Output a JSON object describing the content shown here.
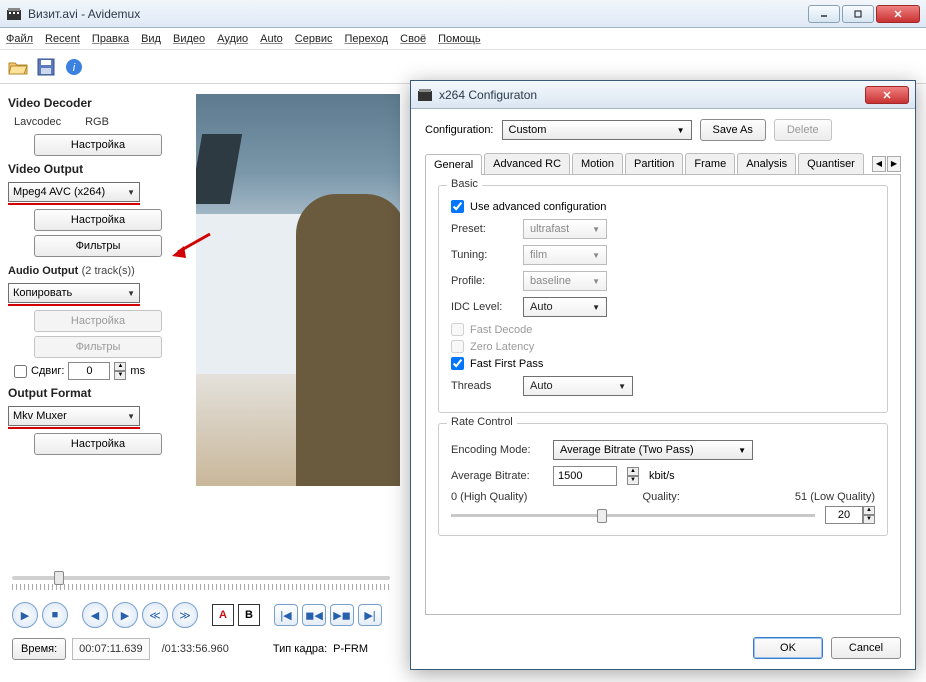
{
  "window": {
    "title": "Визит.avi - Avidemux"
  },
  "menu": [
    "Файл",
    "Recent",
    "Правка",
    "Вид",
    "Видео",
    "Аудио",
    "Auto",
    "Сервис",
    "Переход",
    "Своё",
    "Помощь"
  ],
  "sidebar": {
    "video_decoder": {
      "head": "Video Decoder",
      "lav": "Lavcodec",
      "rgb": "RGB",
      "settings": "Настройка"
    },
    "video_output": {
      "head": "Video Output",
      "codec": "Mpeg4 AVC (x264)",
      "settings": "Настройка",
      "filters": "Фильтры"
    },
    "audio_output": {
      "head": "Audio Output",
      "tracks": "(2 track(s))",
      "mode": "Копировать",
      "settings": "Настройка",
      "filters": "Фильтры",
      "shift_label": "Сдвиг:",
      "shift_value": "0",
      "ms": "ms"
    },
    "output_format": {
      "head": "Output Format",
      "muxer": "Mkv Muxer",
      "settings": "Настройка"
    }
  },
  "status": {
    "time_label": "Время:",
    "time": "00:07:11.639",
    "total": "/01:33:56.960",
    "frame_type_label": "Тип кадра:",
    "frame_type": "P-FRM"
  },
  "dialog": {
    "title": "x264 Configuraton",
    "config_label": "Configuration:",
    "config_value": "Custom",
    "save_as": "Save As",
    "delete": "Delete",
    "tabs": [
      "General",
      "Advanced RC",
      "Motion",
      "Partition",
      "Frame",
      "Analysis",
      "Quantiser"
    ],
    "basic": {
      "title": "Basic",
      "use_adv": "Use advanced configuration",
      "preset_label": "Preset:",
      "preset": "ultrafast",
      "tuning_label": "Tuning:",
      "tuning": "film",
      "profile_label": "Profile:",
      "profile": "baseline",
      "idc_label": "IDC Level:",
      "idc": "Auto",
      "fast_decode": "Fast Decode",
      "zero_latency": "Zero Latency",
      "fast_first": "Fast First Pass",
      "threads_label": "Threads",
      "threads": "Auto"
    },
    "rate": {
      "title": "Rate Control",
      "mode_label": "Encoding Mode:",
      "mode": "Average Bitrate (Two Pass)",
      "bitrate_label": "Average Bitrate:",
      "bitrate": "1500",
      "unit": "kbit/s",
      "q_left": "0 (High Quality)",
      "q_mid": "Quality:",
      "q_right": "51 (Low Quality)",
      "q_value": "20"
    },
    "ok": "OK",
    "cancel": "Cancel"
  }
}
